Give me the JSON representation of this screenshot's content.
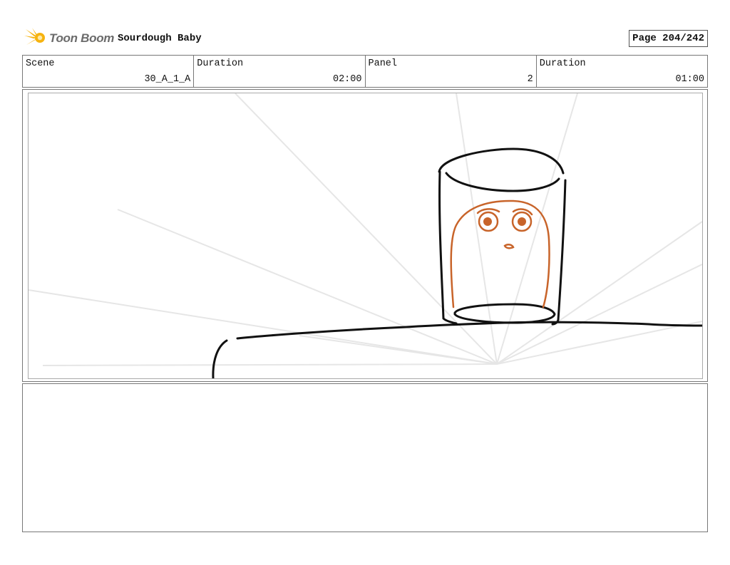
{
  "header": {
    "logo_text": "Toon Boom",
    "project_title": "Sourdough Baby",
    "page": "Page 204/242"
  },
  "info": {
    "scene_label": "Scene",
    "scene_value": "30_A_1_A",
    "scene_duration_label": "Duration",
    "scene_duration_value": "02:00",
    "panel_label": "Panel",
    "panel_value": "2",
    "panel_duration_label": "Duration",
    "panel_duration_value": "01:00"
  },
  "notes": {
    "text": ""
  },
  "colors": {
    "sketch_line": "#111111",
    "character_line": "#c8642a",
    "perspective_line": "#e6e6e6",
    "logo_orange": "#f6b30f"
  }
}
